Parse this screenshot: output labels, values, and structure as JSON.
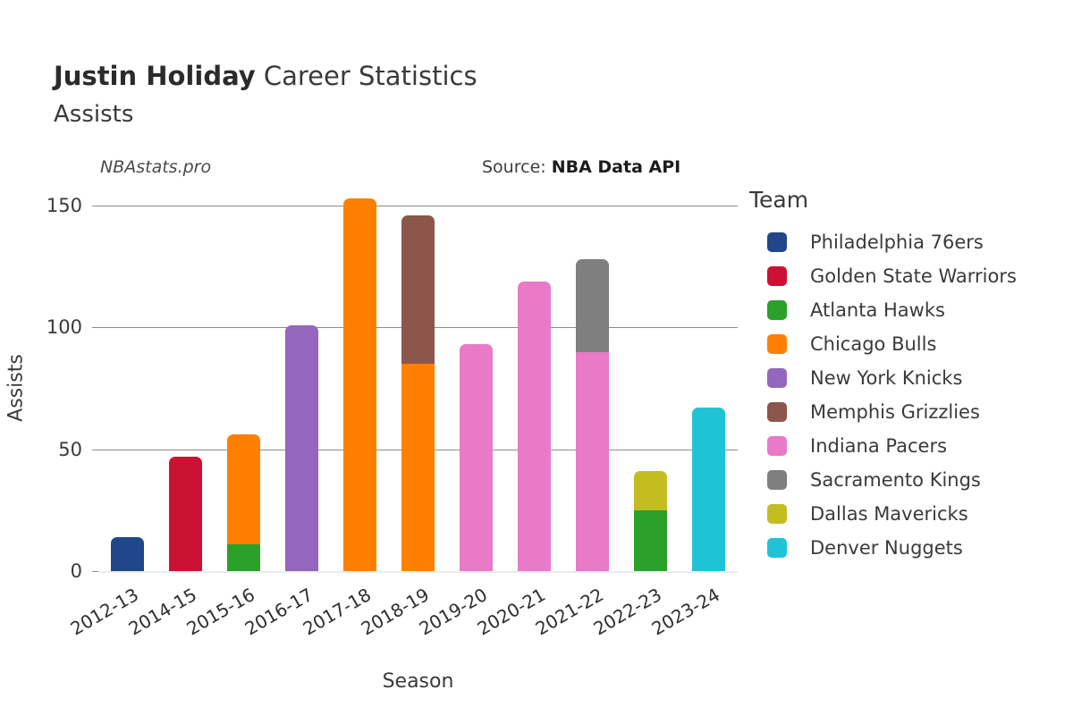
{
  "header": {
    "player_name": "Justin Holiday",
    "title_suffix": " Career Statistics",
    "subtitle": "Assists"
  },
  "annotations": {
    "watermark": "NBAstats.pro",
    "source_label": "Source: ",
    "source_value": "NBA Data API"
  },
  "legend": {
    "title": "Team",
    "items": [
      {
        "label": "Philadelphia 76ers",
        "color": "#1f4789"
      },
      {
        "label": "Golden State Warriors",
        "color": "#cc1234"
      },
      {
        "label": "Atlanta Hawks",
        "color": "#2ba02b"
      },
      {
        "label": "Chicago Bulls",
        "color": "#ff8000"
      },
      {
        "label": "New York Knicks",
        "color": "#9467bd"
      },
      {
        "label": "Memphis Grizzlies",
        "color": "#8c564b"
      },
      {
        "label": "Indiana Pacers",
        "color": "#e87ac8"
      },
      {
        "label": "Sacramento Kings",
        "color": "#7f7f7f"
      },
      {
        "label": "Dallas Mavericks",
        "color": "#c4bd22"
      },
      {
        "label": "Denver Nuggets",
        "color": "#1ec4d6"
      }
    ]
  },
  "chart_data": {
    "type": "bar",
    "stacked": true,
    "title": "Justin Holiday Career Statistics",
    "subtitle": "Assists",
    "xlabel": "Season",
    "ylabel": "Assists",
    "ylim": [
      0,
      160
    ],
    "yticks": [
      0,
      50,
      100,
      150
    ],
    "ytick_labels": [
      "0",
      "50",
      "100",
      "150"
    ],
    "grid": "horizontal",
    "legend_position": "right",
    "legend_title": "Team",
    "categories": [
      "2012-13",
      "2014-15",
      "2015-16",
      "2016-17",
      "2017-18",
      "2018-19",
      "2019-20",
      "2020-21",
      "2021-22",
      "2022-23",
      "2023-24"
    ],
    "series": [
      {
        "name": "Philadelphia 76ers",
        "color": "#1f4789",
        "values": [
          14,
          0,
          0,
          0,
          0,
          0,
          0,
          0,
          0,
          0,
          0
        ]
      },
      {
        "name": "Golden State Warriors",
        "color": "#cc1234",
        "values": [
          0,
          47,
          0,
          0,
          0,
          0,
          0,
          0,
          0,
          0,
          0
        ]
      },
      {
        "name": "Atlanta Hawks",
        "color": "#2ba02b",
        "values": [
          0,
          0,
          11,
          0,
          0,
          0,
          0,
          0,
          0,
          25,
          0
        ]
      },
      {
        "name": "Chicago Bulls",
        "color": "#ff8000",
        "values": [
          0,
          0,
          45,
          153,
          85,
          0,
          0,
          0,
          0,
          0,
          0
        ]
      },
      {
        "name": "New York Knicks",
        "color": "#9467bd",
        "values": [
          0,
          0,
          0,
          0,
          0,
          0,
          0,
          0,
          0,
          0,
          0
        ]
      },
      {
        "name": "Memphis Grizzlies",
        "color": "#8c564b",
        "values": [
          0,
          0,
          0,
          0,
          61,
          0,
          0,
          0,
          0,
          0,
          0
        ]
      },
      {
        "name": "Indiana Pacers",
        "color": "#e87ac8",
        "values": [
          0,
          0,
          0,
          0,
          0,
          93,
          119,
          90,
          0,
          0,
          0
        ]
      },
      {
        "name": "Sacramento Kings",
        "color": "#7f7f7f",
        "values": [
          0,
          0,
          0,
          0,
          0,
          0,
          0,
          38,
          0,
          0,
          0
        ]
      },
      {
        "name": "Dallas Mavericks",
        "color": "#c4bd22",
        "values": [
          0,
          0,
          0,
          0,
          0,
          0,
          0,
          0,
          0,
          16,
          0
        ]
      },
      {
        "name": "Denver Nuggets",
        "color": "#1ec4d6",
        "values": [
          0,
          0,
          0,
          0,
          0,
          0,
          0,
          0,
          0,
          0,
          67
        ]
      }
    ],
    "bars": [
      {
        "category": "2012-13",
        "total": 14,
        "segments": [
          {
            "team": "Philadelphia 76ers",
            "value": 14,
            "color": "#1f4789"
          }
        ]
      },
      {
        "category": "2014-15",
        "total": 47,
        "segments": [
          {
            "team": "Golden State Warriors",
            "value": 47,
            "color": "#cc1234"
          }
        ]
      },
      {
        "category": "2015-16",
        "total": 56,
        "segments": [
          {
            "team": "Atlanta Hawks",
            "value": 11,
            "color": "#2ba02b"
          },
          {
            "team": "Chicago Bulls",
            "value": 45,
            "color": "#ff8000"
          }
        ]
      },
      {
        "category": "2016-17",
        "total": 101,
        "segments": [
          {
            "team": "New York Knicks",
            "value": 101,
            "color": "#9467bd"
          }
        ]
      },
      {
        "category": "2017-18",
        "total": 153,
        "segments": [
          {
            "team": "Chicago Bulls",
            "value": 153,
            "color": "#ff8000"
          }
        ]
      },
      {
        "category": "2018-19",
        "total": 146,
        "segments": [
          {
            "team": "Chicago Bulls",
            "value": 85,
            "color": "#ff8000"
          },
          {
            "team": "Memphis Grizzlies",
            "value": 61,
            "color": "#8c564b"
          }
        ]
      },
      {
        "category": "2019-20",
        "total": 93,
        "segments": [
          {
            "team": "Indiana Pacers",
            "value": 93,
            "color": "#e87ac8"
          }
        ]
      },
      {
        "category": "2020-21",
        "total": 119,
        "segments": [
          {
            "team": "Indiana Pacers",
            "value": 119,
            "color": "#e87ac8"
          }
        ]
      },
      {
        "category": "2021-22",
        "total": 128,
        "segments": [
          {
            "team": "Indiana Pacers",
            "value": 90,
            "color": "#e87ac8"
          },
          {
            "team": "Sacramento Kings",
            "value": 38,
            "color": "#7f7f7f"
          }
        ]
      },
      {
        "category": "2022-23",
        "total": 41,
        "segments": [
          {
            "team": "Atlanta Hawks",
            "value": 25,
            "color": "#2ba02b"
          },
          {
            "team": "Dallas Mavericks",
            "value": 16,
            "color": "#c4bd22"
          }
        ]
      },
      {
        "category": "2023-24",
        "total": 67,
        "segments": [
          {
            "team": "Denver Nuggets",
            "value": 67,
            "color": "#1ec4d6"
          }
        ]
      }
    ]
  }
}
